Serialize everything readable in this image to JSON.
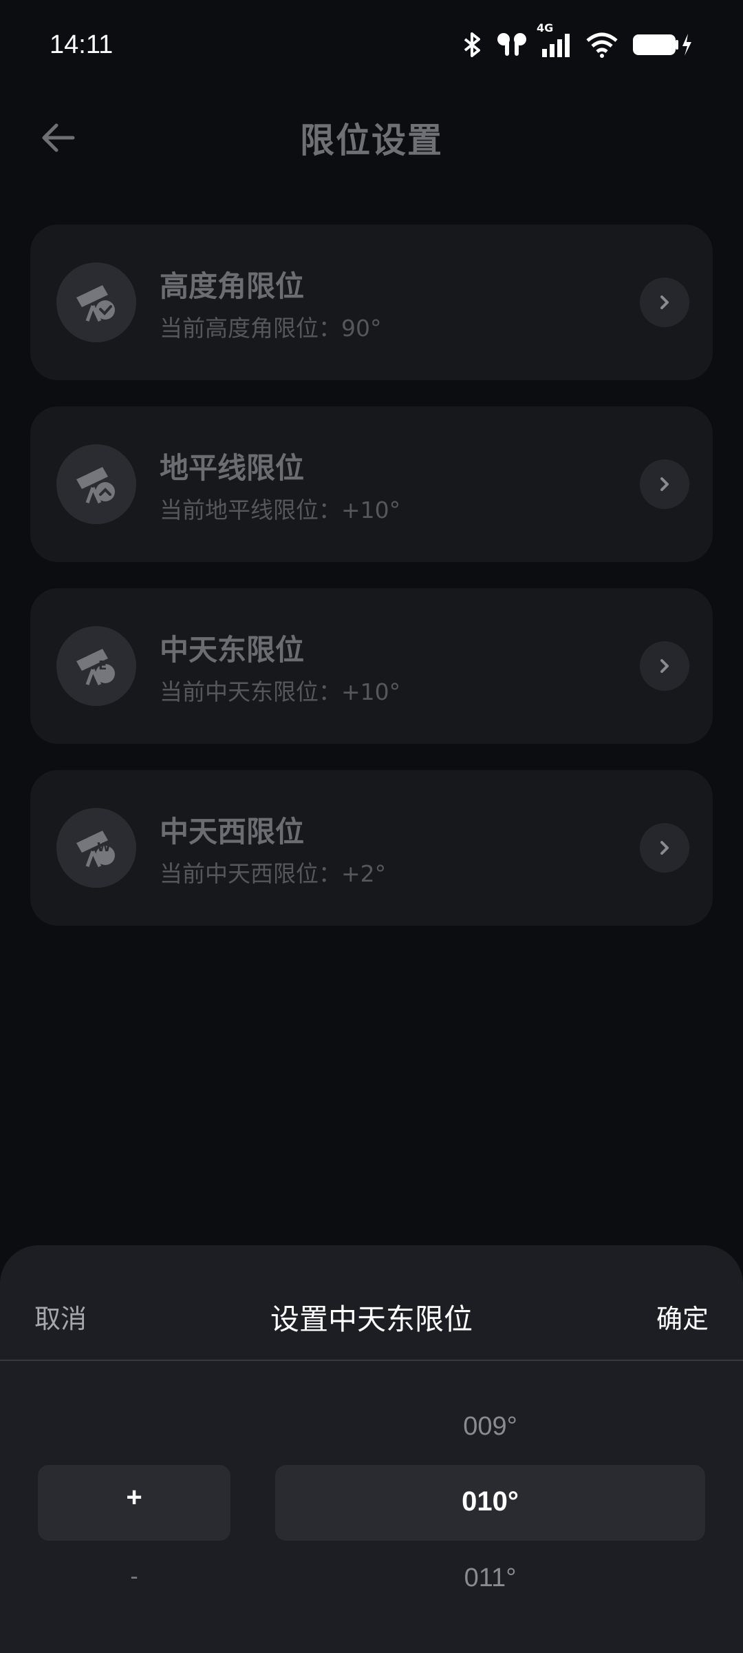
{
  "status_bar": {
    "time": "14:11",
    "icons": [
      "bluetooth-icon",
      "earbuds-icon",
      "signal-4g-icon",
      "wifi-icon",
      "battery-charging-icon"
    ],
    "network_label": "4G"
  },
  "header": {
    "back_icon": "arrow-left-icon",
    "title": "限位设置"
  },
  "limits": [
    {
      "title": "高度角限位",
      "subtitle": "当前高度角限位：90°",
      "icon": "telescope-check-icon"
    },
    {
      "title": "地平线限位",
      "subtitle": "当前地平线限位：+10°",
      "icon": "telescope-up-icon"
    },
    {
      "title": "中天东限位",
      "subtitle": "当前中天东限位：+10°",
      "icon": "telescope-e-icon",
      "badge": "E"
    },
    {
      "title": "中天西限位",
      "subtitle": "当前中天西限位：+2°",
      "icon": "telescope-w-icon",
      "badge": "W"
    }
  ],
  "sheet": {
    "cancel_label": "取消",
    "title": "设置中天东限位",
    "confirm_label": "确定",
    "sign_picker": {
      "selected": "+",
      "below": "-"
    },
    "value_picker": {
      "above": "009°",
      "selected": "010°",
      "below": "011°"
    }
  },
  "colors": {
    "background": "#0c0d10",
    "card": "#17181c",
    "sheet": "#1d1e23",
    "highlight": "#2a2b30"
  }
}
